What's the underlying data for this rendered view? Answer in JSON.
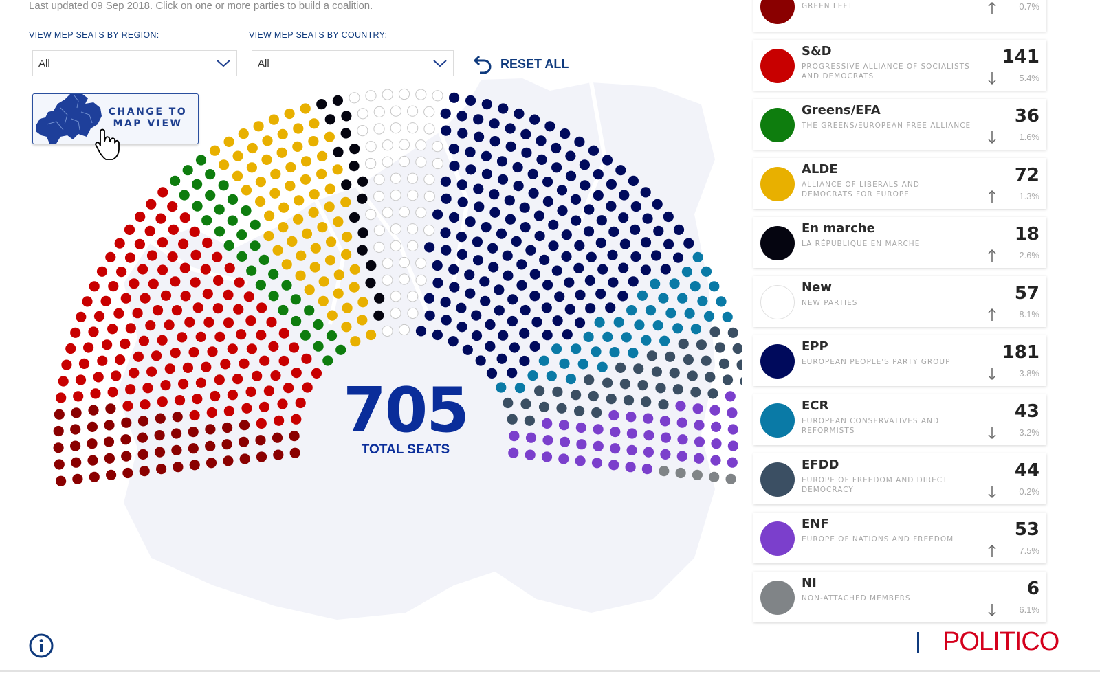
{
  "header": {
    "updated": "Last updated 09 Sep 2018. Click on one or more parties to build a coalition."
  },
  "filters": {
    "region_label": "VIEW MEP SEATS BY REGION:",
    "region_value": "All",
    "country_label": "VIEW MEP SEATS BY COUNTRY:",
    "country_value": "All",
    "reset_label": "RESET ALL"
  },
  "map_button": {
    "label_line1": "CHANGE TO",
    "label_line2": "MAP VIEW"
  },
  "hemicycle": {
    "total": "705",
    "total_label": "TOTAL SEATS"
  },
  "parties_top": {
    "full": "GREEN LEFT",
    "pct": "0.7%",
    "trend": "up",
    "color": "#8a0000"
  },
  "parties": [
    {
      "name": "S&D",
      "full": "PROGRESSIVE ALLIANCE OF SOCIALISTS AND DEMOCRATS",
      "seats": "141",
      "pct": "5.4%",
      "trend": "down",
      "color": "#c80000"
    },
    {
      "name": "Greens/EFA",
      "full": "THE GREENS/EUROPEAN FREE ALLIANCE",
      "seats": "36",
      "pct": "1.6%",
      "trend": "down",
      "color": "#0e7d0e"
    },
    {
      "name": "ALDE",
      "full": "ALLIANCE OF LIBERALS AND DEMOCRATS FOR EUROPE",
      "seats": "72",
      "pct": "1.3%",
      "trend": "up",
      "color": "#e8b000"
    },
    {
      "name": "En marche",
      "full": "LA RÉPUBLIQUE EN MARCHE",
      "seats": "18",
      "pct": "2.6%",
      "trend": "up",
      "color": "#050510"
    },
    {
      "name": "New",
      "full": "NEW PARTIES",
      "seats": "57",
      "pct": "8.1%",
      "trend": "up",
      "color": "#ffffff"
    },
    {
      "name": "EPP",
      "full": "EUROPEAN PEOPLE'S PARTY GROUP",
      "seats": "181",
      "pct": "3.8%",
      "trend": "down",
      "color": "#000a5c"
    },
    {
      "name": "ECR",
      "full": "EUROPEAN CONSERVATIVES AND REFORMISTS",
      "seats": "43",
      "pct": "3.2%",
      "trend": "down",
      "color": "#0a7aa6"
    },
    {
      "name": "EFDD",
      "full": "EUROPE OF FREEDOM AND DIRECT DEMOCRACY",
      "seats": "44",
      "pct": "0.2%",
      "trend": "down",
      "color": "#3b4f63"
    },
    {
      "name": "ENF",
      "full": "EUROPE OF NATIONS AND FREEDOM",
      "seats": "53",
      "pct": "7.5%",
      "trend": "up",
      "color": "#7b3fcc"
    },
    {
      "name": "NI",
      "full": "NON-ATTACHED MEMBERS",
      "seats": "6",
      "pct": "6.1%",
      "trend": "down",
      "color": "#808487"
    }
  ],
  "hemicycle_colors": [
    "#8a0000",
    "#c80000",
    "#0e7d0e",
    "#e8b000",
    "#050510",
    "#ffffff",
    "#000a5c",
    "#0a7aa6",
    "#3b4f63",
    "#7b3fcc",
    "#808487"
  ],
  "hemicycle_counts": [
    54,
    141,
    36,
    72,
    18,
    57,
    181,
    43,
    44,
    53,
    6
  ],
  "footer": {
    "logo": "POLITICO",
    "accent": "#d4001c",
    "brand_blue": "#0f3a7d"
  }
}
